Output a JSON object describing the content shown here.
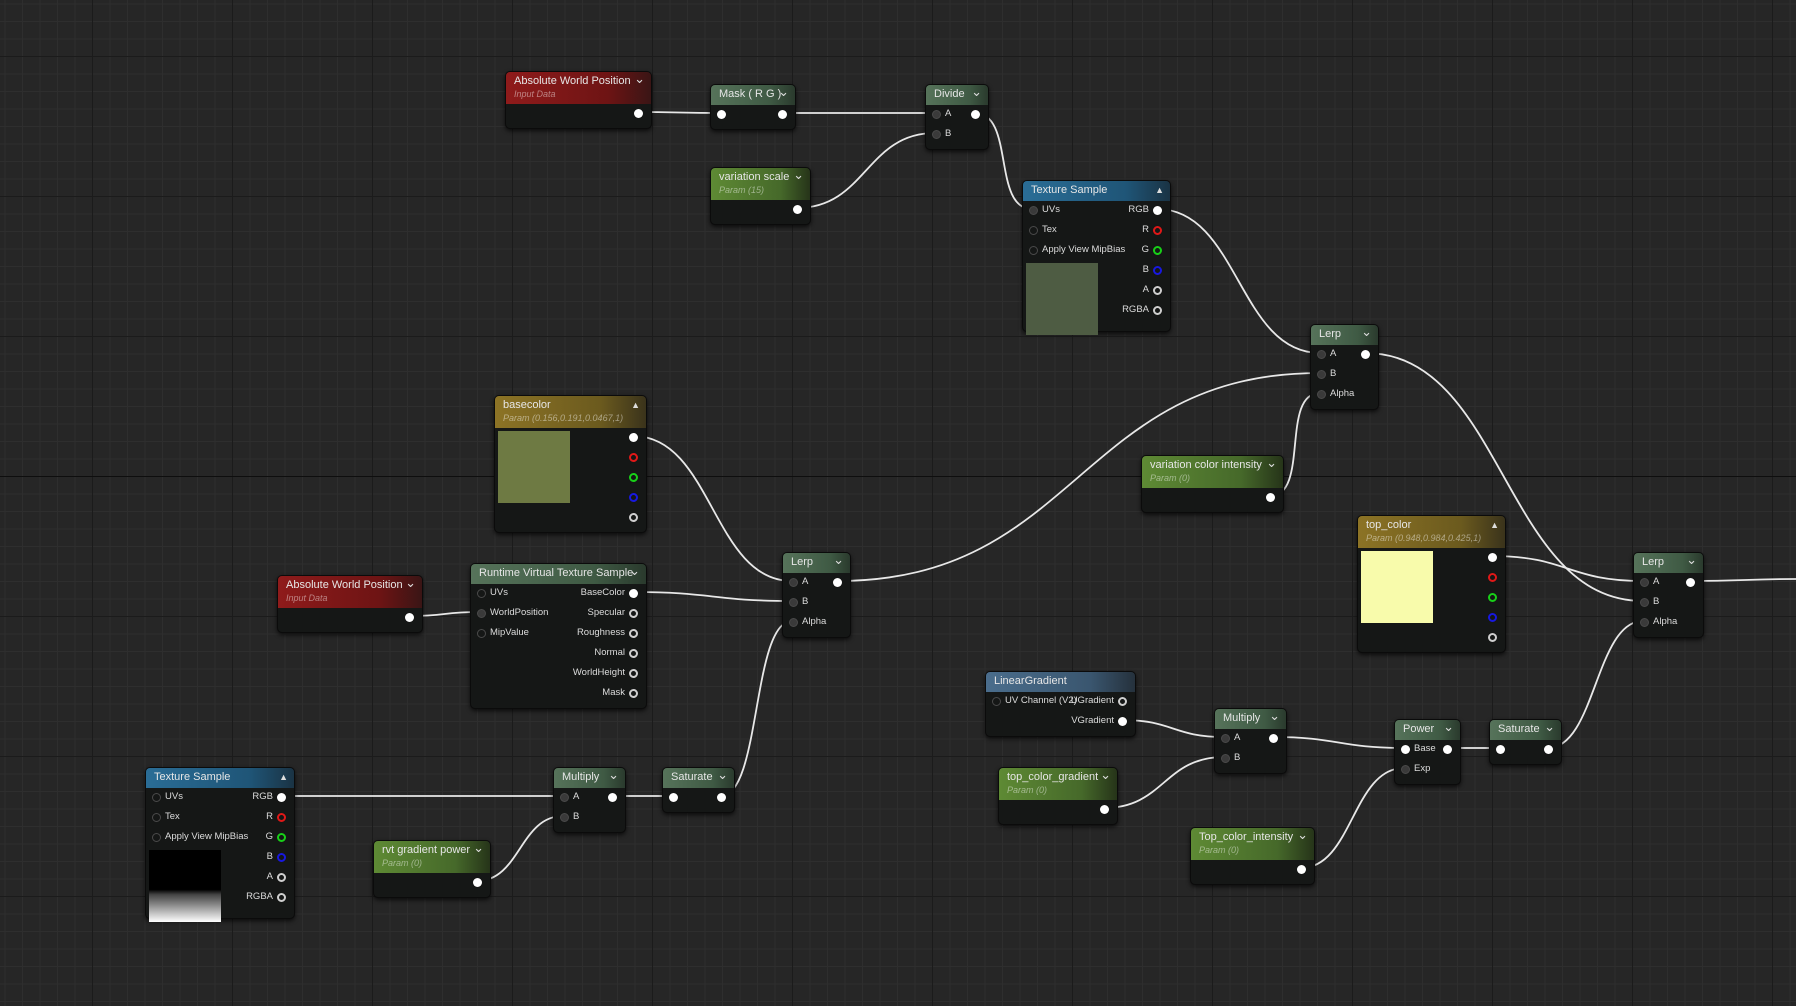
{
  "graph": {
    "nodes": [
      {
        "id": "awp1",
        "title": "Absolute World Position",
        "subtitle": "Input Data",
        "kind": "input",
        "chevron": "down",
        "inputs": [],
        "outputs": [
          ""
        ]
      },
      {
        "id": "mask",
        "title": "Mask ( R G )",
        "kind": "math",
        "chevron": "down",
        "inputs": [
          ""
        ],
        "outputs": [
          ""
        ]
      },
      {
        "id": "divide",
        "title": "Divide",
        "kind": "math",
        "chevron": "down",
        "inputs": [
          "A",
          "B"
        ],
        "outputs": [
          ""
        ]
      },
      {
        "id": "vscale",
        "title": "variation scale",
        "subtitle": "Param (15)",
        "kind": "param",
        "chevron": "down",
        "inputs": [],
        "outputs": [
          ""
        ]
      },
      {
        "id": "tex1",
        "title": "Texture Sample",
        "kind": "texture",
        "chevron": "up",
        "inputs": [
          "UVs",
          "Tex",
          "Apply View MipBias"
        ],
        "outputs": [
          "RGB",
          "R",
          "G",
          "B",
          "A",
          "RGBA"
        ],
        "preview": "#4e5c43"
      },
      {
        "id": "lerp1",
        "title": "Lerp",
        "kind": "math",
        "chevron": "down",
        "inputs": [
          "A",
          "B",
          "Alpha"
        ],
        "outputs": [
          ""
        ]
      },
      {
        "id": "basecolor",
        "title": "basecolor",
        "subtitle": "Param (0.156,0.191,0.0467,1)",
        "kind": "vector",
        "chevron": "up",
        "inputs": [],
        "outputs": [
          "",
          "",
          "",
          "",
          ""
        ],
        "preview": "#6e7a43"
      },
      {
        "id": "vci",
        "title": "variation color intensity",
        "subtitle": "Param (0)",
        "kind": "param",
        "chevron": "down",
        "inputs": [],
        "outputs": [
          ""
        ]
      },
      {
        "id": "topcolor",
        "title": "top_color",
        "subtitle": "Param (0.948,0.984,0.425,1)",
        "kind": "vector",
        "chevron": "up",
        "inputs": [],
        "outputs": [
          "",
          "",
          "",
          "",
          ""
        ],
        "preview": "#f8fbab"
      },
      {
        "id": "lerp2",
        "title": "Lerp",
        "kind": "math",
        "chevron": "down",
        "inputs": [
          "A",
          "B",
          "Alpha"
        ],
        "outputs": [
          ""
        ]
      },
      {
        "id": "awp2",
        "title": "Absolute World Position",
        "subtitle": "Input Data",
        "kind": "input",
        "chevron": "down",
        "inputs": [],
        "outputs": [
          ""
        ]
      },
      {
        "id": "rvt",
        "title": "Runtime Virtual Texture Sample",
        "kind": "math",
        "chevron": "down",
        "inputs": [
          "UVs",
          "WorldPosition",
          "MipValue"
        ],
        "outputs": [
          "BaseColor",
          "Specular",
          "Roughness",
          "Normal",
          "WorldHeight",
          "Mask"
        ]
      },
      {
        "id": "lerpmid",
        "title": "Lerp",
        "kind": "math",
        "chevron": "down",
        "inputs": [
          "A",
          "B",
          "Alpha"
        ],
        "outputs": [
          ""
        ]
      },
      {
        "id": "lingrad",
        "title": "LinearGradient",
        "kind": "gradient",
        "chevron": "",
        "inputs": [
          "UV Channel (V2)"
        ],
        "outputs": [
          "UGradient",
          "VGradient"
        ]
      },
      {
        "id": "mul1",
        "title": "Multiply",
        "kind": "math",
        "chevron": "down",
        "inputs": [
          "A",
          "B"
        ],
        "outputs": [
          ""
        ]
      },
      {
        "id": "tcg",
        "title": "top_color_gradient",
        "subtitle": "Param (0)",
        "kind": "param",
        "chevron": "down",
        "inputs": [],
        "outputs": [
          ""
        ]
      },
      {
        "id": "power",
        "title": "Power",
        "kind": "math",
        "chevron": "down",
        "inputs": [
          "Base",
          "Exp"
        ],
        "outputs": [
          ""
        ]
      },
      {
        "id": "sat1",
        "title": "Saturate",
        "kind": "math",
        "chevron": "down",
        "inputs": [
          ""
        ],
        "outputs": [
          ""
        ]
      },
      {
        "id": "tci",
        "title": "Top_color_intensity",
        "subtitle": "Param (0)",
        "kind": "param",
        "chevron": "down",
        "inputs": [],
        "outputs": [
          ""
        ]
      },
      {
        "id": "tex2",
        "title": "Texture Sample",
        "kind": "texture",
        "chevron": "up",
        "inputs": [
          "UVs",
          "Tex",
          "Apply View MipBias"
        ],
        "outputs": [
          "RGB",
          "R",
          "G",
          "B",
          "A",
          "RGBA"
        ],
        "preview": "gradient-black-white"
      },
      {
        "id": "mul2",
        "title": "Multiply",
        "kind": "math",
        "chevron": "down",
        "inputs": [
          "A",
          "B"
        ],
        "outputs": [
          ""
        ]
      },
      {
        "id": "rvtgp",
        "title": "rvt gradient power",
        "subtitle": "Param (0)",
        "kind": "param",
        "chevron": "down",
        "inputs": [],
        "outputs": [
          ""
        ]
      },
      {
        "id": "sat2",
        "title": "Saturate",
        "kind": "math",
        "chevron": "down",
        "inputs": [
          ""
        ],
        "outputs": [
          ""
        ]
      }
    ],
    "pin_colors": {
      "R": "#e01818",
      "G": "#18d018",
      "B": "#1818e0",
      "default": "#cfcfcf"
    }
  }
}
